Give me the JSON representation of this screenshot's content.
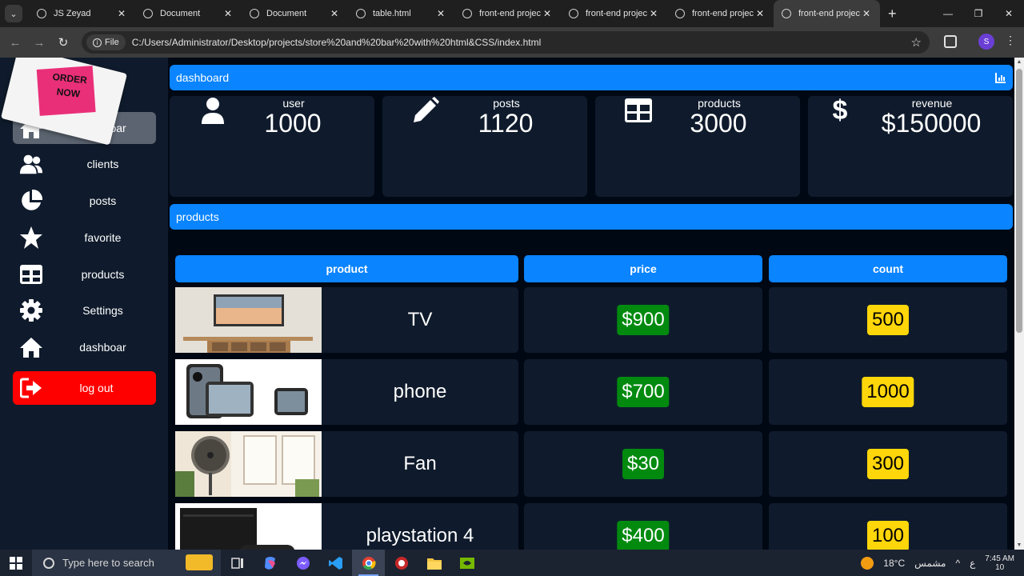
{
  "browser": {
    "tabs": [
      {
        "label": "JS Zeyad",
        "active": false
      },
      {
        "label": "Document",
        "active": false
      },
      {
        "label": "Document",
        "active": false
      },
      {
        "label": "table.html",
        "active": false
      },
      {
        "label": "front-end projec",
        "active": false
      },
      {
        "label": "front-end projec",
        "active": false
      },
      {
        "label": "front-end projec",
        "active": false
      },
      {
        "label": "front-end projec",
        "active": true
      }
    ],
    "file_chip": "File",
    "url": "C:/Users/Administrator/Desktop/projects/store%20and%20bar%20with%20html&CSS/index.html",
    "profile_initial": "S"
  },
  "sidebar": {
    "sticker_text": "ORDER NOW",
    "items": [
      {
        "label": "dashboar",
        "icon": "home-icon",
        "active": true
      },
      {
        "label": "clients",
        "icon": "users-icon",
        "active": false
      },
      {
        "label": "posts",
        "icon": "pie-chart-icon",
        "active": false
      },
      {
        "label": "favorite",
        "icon": "star-icon",
        "active": false
      },
      {
        "label": "products",
        "icon": "table-icon",
        "active": false
      },
      {
        "label": "Settings",
        "icon": "gear-icon",
        "active": false
      },
      {
        "label": "dashboar",
        "icon": "home-icon",
        "active": false
      }
    ],
    "logout_label": "log out"
  },
  "dashboard": {
    "title": "dashboard",
    "cards": [
      {
        "label": "user",
        "value": "1000",
        "icon": "user-icon"
      },
      {
        "label": "posts",
        "value": "1120",
        "icon": "pencil-icon"
      },
      {
        "label": "products",
        "value": "3000",
        "icon": "table-icon"
      },
      {
        "label": "revenue",
        "value": "$150000",
        "icon": "dollar-icon"
      }
    ]
  },
  "products": {
    "title": "products",
    "headers": [
      "product",
      "price",
      "count"
    ],
    "rows": [
      {
        "name": "TV",
        "price": "$900",
        "count": "500",
        "image": "tv-image"
      },
      {
        "name": "phone",
        "price": "$700",
        "count": "1000",
        "image": "phone-image"
      },
      {
        "name": "Fan",
        "price": "$30",
        "count": "300",
        "image": "fan-image"
      },
      {
        "name": "playstation 4",
        "price": "$400",
        "count": "100",
        "image": "playstation-image"
      }
    ]
  },
  "colors": {
    "accent": "#0a84ff",
    "panel": "#0f1b2c",
    "background": "#000814",
    "price_badge": "#028a0f",
    "count_badge": "#ffd60a",
    "logout": "#ff0000"
  },
  "taskbar": {
    "search_placeholder": "Type here to search",
    "weather_temp": "18°C",
    "weather_label": "مشمس",
    "language": "ع",
    "time": "7:45 AM",
    "date": "10"
  }
}
